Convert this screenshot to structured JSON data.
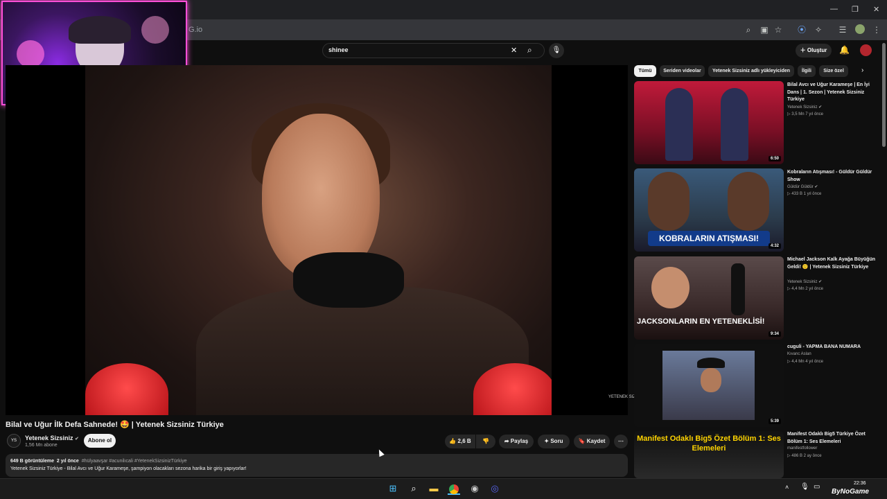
{
  "browser": {
    "url_partial": "G.io",
    "window_controls": [
      "—",
      "❐",
      "✕"
    ]
  },
  "youtube": {
    "search": {
      "value": "shinee",
      "clear_icon": "close-icon",
      "search_icon": "search-icon",
      "mic_icon": "mic-icon"
    },
    "create_label": "Oluştur"
  },
  "video": {
    "title": "Bilal ve Uğur İlk Defa Sahnede! 🤩 | Yetenek Sizsiniz Türkiye",
    "watermark": "YETENEK SIZSINIZ",
    "channel": {
      "name": "Yetenek Sizsiniz",
      "verified": "✔",
      "subs": "1,56 Mn abone",
      "avatar_text": "YS"
    },
    "subscribe_label": "Abone ol",
    "actions": {
      "like": "2,6 B",
      "share": "Paylaş",
      "ask": "Soru",
      "save": "Kaydet",
      "more": "⋯"
    },
    "description": {
      "views": "649 B görüntüleme",
      "date": "2 yıl önce",
      "tags": "#hülyaavşar #acunilıcali #YetenekSizsinizTürkiye",
      "text": "Yetenek Sizsiniz Türkiye - Bilal Avcı ve Uğur Karameşe, şampiyon olacakları sezona harika bir giriş yapıyorlar!"
    }
  },
  "chips": [
    "Tümü",
    "Seriden videolar",
    "Yetenek Sizsiniz adlı yükleyiciden",
    "İlgili",
    "Size özel"
  ],
  "recommendations": [
    {
      "title": "Bilal Avcı ve Uğur Karameşe | En İyi Dans | 1. Sezon | Yetenek Sizsiniz Türkiye",
      "channel": "Yetenek Sizsiniz ✔",
      "meta": "▷ 3,5 Mn   7 yıl önce",
      "duration": "6:50",
      "caption": ""
    },
    {
      "title": "Kobraların Atışması! - Güldür Güldür Show",
      "channel": "Güldür Güldür ✔",
      "meta": "▷ 433 B   1 yıl önce",
      "duration": "4:32",
      "caption": "KOBRALARIN ATIŞMASI!"
    },
    {
      "title": "Michael Jackson Kalk Ayağa Büyüğün Geldi! 🙂 | Yetenek Sizsiniz Türkiye",
      "channel": "Yetenek Sizsiniz ✔",
      "meta": "▷ 4,4 Mn   2 yıl önce",
      "duration": "9:34",
      "caption": "JACKSONLARIN EN YETENEKLİSİ!"
    },
    {
      "title": "cuguli - YAPMA BANA NUMARA",
      "channel": "Kıvanc Aslan",
      "meta": "▷ 4,4 Mn   4 yıl önce",
      "duration": "5:39",
      "caption": ""
    },
    {
      "title": "Manifest Odaklı Big5 Türkiye Özet Bölüm 1: Ses Elemeleri",
      "channel": "manifestfollower",
      "meta": "▷ 486 B   2 ay önce",
      "duration": "",
      "caption": "Manifest Odaklı Big5 Özet Bölüm 1: Ses Elemeleri"
    }
  ],
  "taskbar": {
    "time": "22:36",
    "date": "",
    "brand": "ByNoGame"
  },
  "colors": {
    "accent": "#ff4fd8",
    "background": "#0f0f0f",
    "chip": "#272727"
  }
}
